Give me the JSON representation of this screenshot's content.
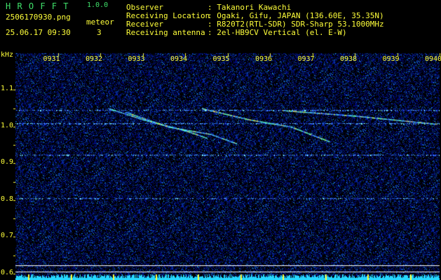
{
  "app": {
    "name": "H R O F F T",
    "version": "1.0.0",
    "filename": "2506170930.png",
    "datetime": "25.06.17 09:30",
    "meteor_label": "meteor",
    "meteor_count": "3"
  },
  "info": {
    "observer_label": "Observer",
    "observer_value": ": Takanori Kawachi",
    "location_label": "Receiving Location",
    "location_value": ": Ogaki, Gifu, JAPAN (136.60E, 35.35N)",
    "receiver_label": "Receiver",
    "receiver_value": ": R820T2(RTL-SDR) SDR-Sharp 53.1000MHz",
    "antenna_label": "Receiving antenna",
    "antenna_value": ": 2el-HB9CV Vertical (el. E-W)"
  },
  "colors": {
    "app_title": "#3fe06a",
    "header_text": "#ffff3a",
    "axis_text": "#ffff3a",
    "background": "#000000",
    "noise": "#0a1a9a"
  },
  "chart_data": {
    "type": "heatmap",
    "ylabel": "kHz",
    "y_ticks": [
      "1.1",
      "1.0",
      "0.9",
      "0.8",
      "0.7",
      "0.6"
    ],
    "x_ticks": [
      "0931",
      "0932",
      "0933",
      "0934",
      "0935",
      "0936",
      "0937",
      "0938",
      "0939",
      "0940"
    ],
    "xlim": [
      0,
      10
    ],
    "ylim": [
      0.59,
      1.2
    ],
    "horizontal_lines": [
      {
        "freq": 1.045,
        "strength": 0.6
      },
      {
        "freq": 1.01,
        "strength": 0.7
      },
      {
        "freq": 0.924,
        "strength": 0.65
      },
      {
        "freq": 0.806,
        "strength": 0.45
      },
      {
        "freq": 0.622,
        "strength": 1.0,
        "color": "#ffffff"
      },
      {
        "freq": 0.605,
        "strength": 1.0,
        "color": "#ffffff"
      }
    ],
    "meteor_traces": [
      {
        "t": [
          2.2,
          3.0,
          4.0,
          4.5
        ],
        "f": [
          1.05,
          1.02,
          0.99,
          0.97
        ]
      },
      {
        "t": [
          2.6,
          3.6,
          4.6,
          5.2
        ],
        "f": [
          1.04,
          1.0,
          0.98,
          0.955
        ]
      },
      {
        "t": [
          4.4,
          5.5,
          6.5,
          7.4
        ],
        "f": [
          1.05,
          1.02,
          1.0,
          0.96
        ]
      },
      {
        "t": [
          6.3,
          8.0,
          9.3,
          9.9
        ],
        "f": [
          1.045,
          1.03,
          1.015,
          1.008
        ]
      }
    ]
  }
}
